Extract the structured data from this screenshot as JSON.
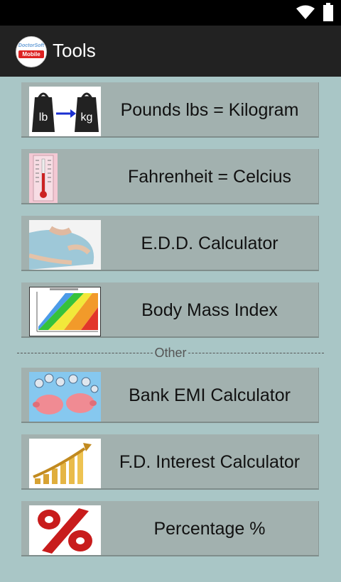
{
  "app": {
    "title": "Tools",
    "logo_top": "DoctorSoft",
    "logo_bottom": "Mobile"
  },
  "status": {
    "icons": [
      "wifi-icon",
      "battery-icon"
    ]
  },
  "tools": [
    {
      "label": "Pounds lbs = Kilogram",
      "icon": "weight-conversion-icon",
      "icon_text": [
        "lb",
        "kg"
      ]
    },
    {
      "label": "Fahrenheit = Celcius",
      "icon": "thermometer-icon"
    },
    {
      "label": "E.D.D. Calculator",
      "icon": "pregnancy-image"
    },
    {
      "label": "Body Mass Index",
      "icon": "bmi-chart-image"
    }
  ],
  "separator": "Other",
  "other_tools": [
    {
      "label": "Bank EMI Calculator",
      "icon": "piggy-bank-image"
    },
    {
      "label": "F.D. Interest Calculator",
      "icon": "growth-bars-image"
    },
    {
      "label": "Percentage %",
      "icon": "percent-icon"
    }
  ],
  "colors": {
    "background": "#a9c6c6",
    "item": "#a2b1af",
    "appbar": "#222222"
  }
}
